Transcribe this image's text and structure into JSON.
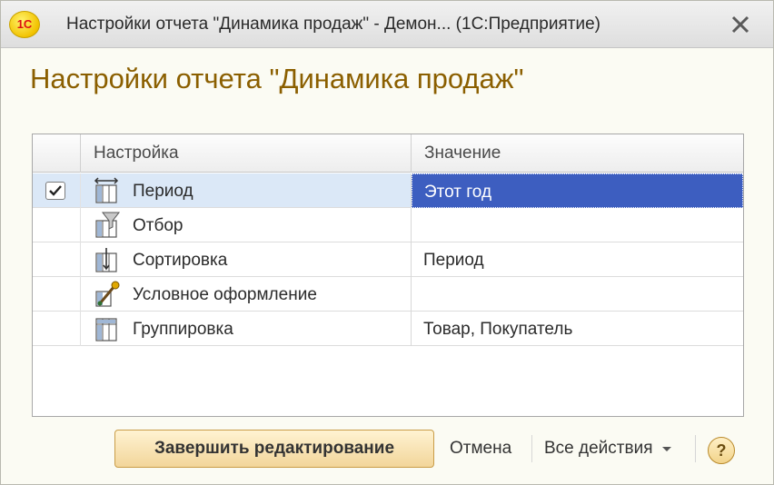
{
  "window": {
    "app_logo_text": "1С",
    "title": "Настройки отчета \"Динамика продаж\" - Демон... (1С:Предприятие)"
  },
  "form": {
    "title": "Настройки отчета \"Динамика продаж\""
  },
  "grid": {
    "columns": [
      "Настройка",
      "Значение"
    ],
    "rows": [
      {
        "label": "Период",
        "value": "Этот год",
        "checked": true,
        "selected": true,
        "icon": "period-icon"
      },
      {
        "label": "Отбор",
        "value": "",
        "icon": "filter-icon"
      },
      {
        "label": "Сортировка",
        "value": "Период",
        "icon": "sort-icon"
      },
      {
        "label": "Условное оформление",
        "value": "",
        "icon": "conditional-format-icon"
      },
      {
        "label": "Группировка",
        "value": "Товар, Покупатель",
        "icon": "grouping-icon"
      }
    ]
  },
  "footer": {
    "finish_label": "Завершить редактирование",
    "cancel_label": "Отмена",
    "all_actions_label": "Все действия",
    "help_label": "?"
  },
  "colors": {
    "title_text": "#8b5f00",
    "selection": "#3d5ec0",
    "row_selected_bg": "#dbe8f7",
    "primary_button": "#f2d59a"
  }
}
